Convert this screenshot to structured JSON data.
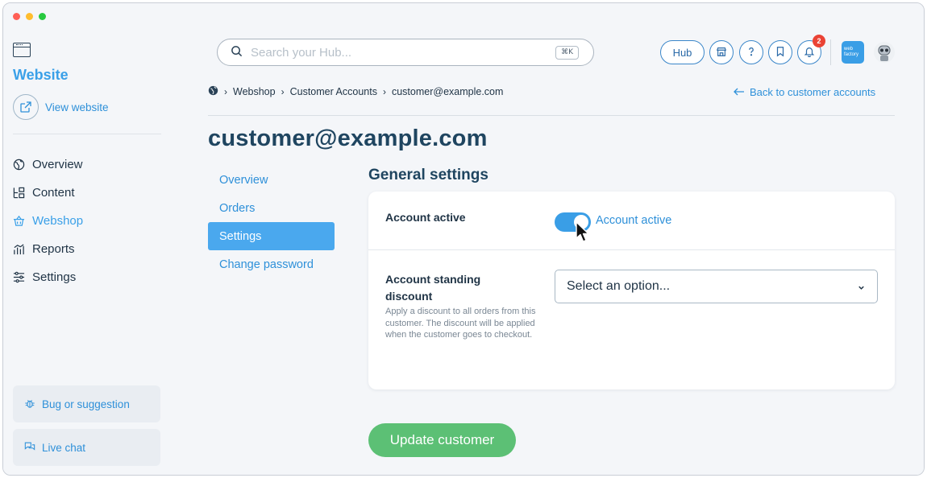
{
  "sidebar": {
    "title": "Website",
    "view_website": "View website",
    "nav": [
      {
        "label": "Overview",
        "icon": "globe-icon"
      },
      {
        "label": "Content",
        "icon": "content-icon"
      },
      {
        "label": "Webshop",
        "icon": "basket-icon"
      },
      {
        "label": "Reports",
        "icon": "reports-icon"
      },
      {
        "label": "Settings",
        "icon": "sliders-icon"
      }
    ],
    "active_nav": "Webshop",
    "bug_button": "Bug or suggestion",
    "chat_button": "Live chat"
  },
  "header": {
    "search_placeholder": "Search your Hub...",
    "search_shortcut": "⌘K",
    "hub_label": "Hub",
    "notification_count": "2",
    "brand_logo_text": "web factory"
  },
  "breadcrumb": {
    "items": [
      "Webshop",
      "Customer Accounts",
      "customer@example.com"
    ],
    "back_link": "Back to customer accounts"
  },
  "page": {
    "title": "customer@example.com",
    "subnav": [
      "Overview",
      "Orders",
      "Settings",
      "Change password"
    ],
    "active_subnav": "Settings",
    "section_title": "General settings"
  },
  "form": {
    "account_active_label": "Account active",
    "account_active_toggle_label": "Account active",
    "account_active_value": true,
    "discount_label": "Account standing discount",
    "discount_help": "Apply a discount to all orders from this customer. The discount will be applied when the customer goes to checkout.",
    "discount_select_value": "Select an option..."
  },
  "actions": {
    "update_label": "Update customer"
  },
  "colors": {
    "accent": "#3aa0e8",
    "primary_text": "#1f4560",
    "success": "#5cc075",
    "badge": "#ea4335"
  }
}
